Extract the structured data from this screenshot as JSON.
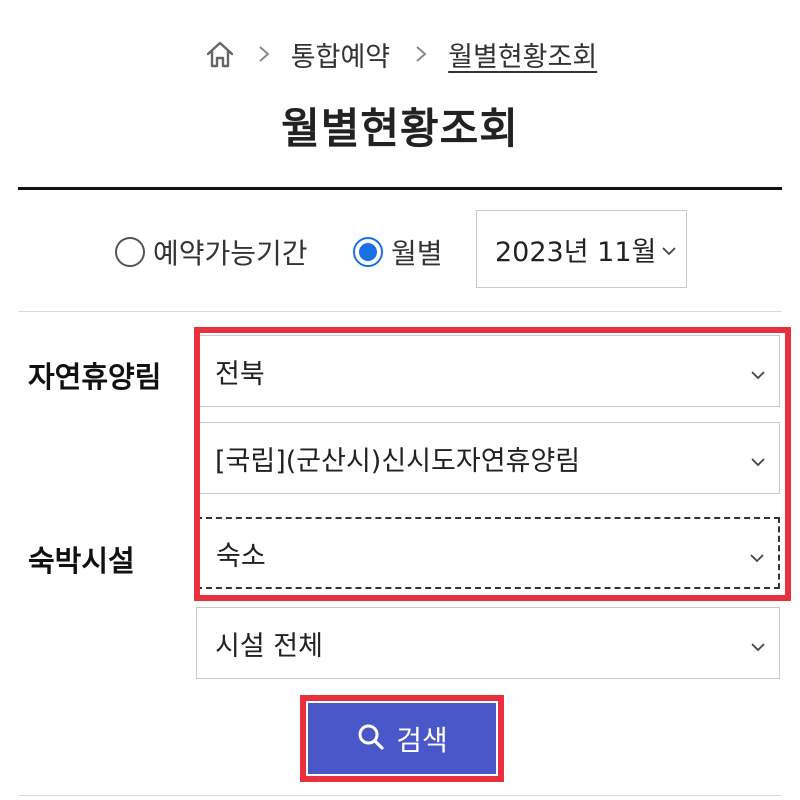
{
  "breadcrumb": {
    "home_icon": "home-icon",
    "items": [
      "통합예약",
      "월별현황조회"
    ]
  },
  "page_title": "월별현황조회",
  "period": {
    "options": [
      {
        "label": "예약가능기간",
        "checked": false
      },
      {
        "label": "월별",
        "checked": true
      }
    ],
    "month_select": {
      "value": "2023년 11월"
    }
  },
  "forest": {
    "label": "자연휴양림",
    "region_select": {
      "value": "전북"
    },
    "forest_select": {
      "value": "[국립](군산시)신시도자연휴양림"
    }
  },
  "lodging": {
    "label": "숙박시설",
    "type_select": {
      "value": "숙소"
    },
    "facility_select": {
      "value": "시설 전체"
    }
  },
  "search_button": {
    "label": "검색",
    "icon": "search-icon"
  },
  "colors": {
    "accent": "#4a57c8",
    "radio_checked": "#1a6fe6",
    "highlight": "#e9303c"
  }
}
